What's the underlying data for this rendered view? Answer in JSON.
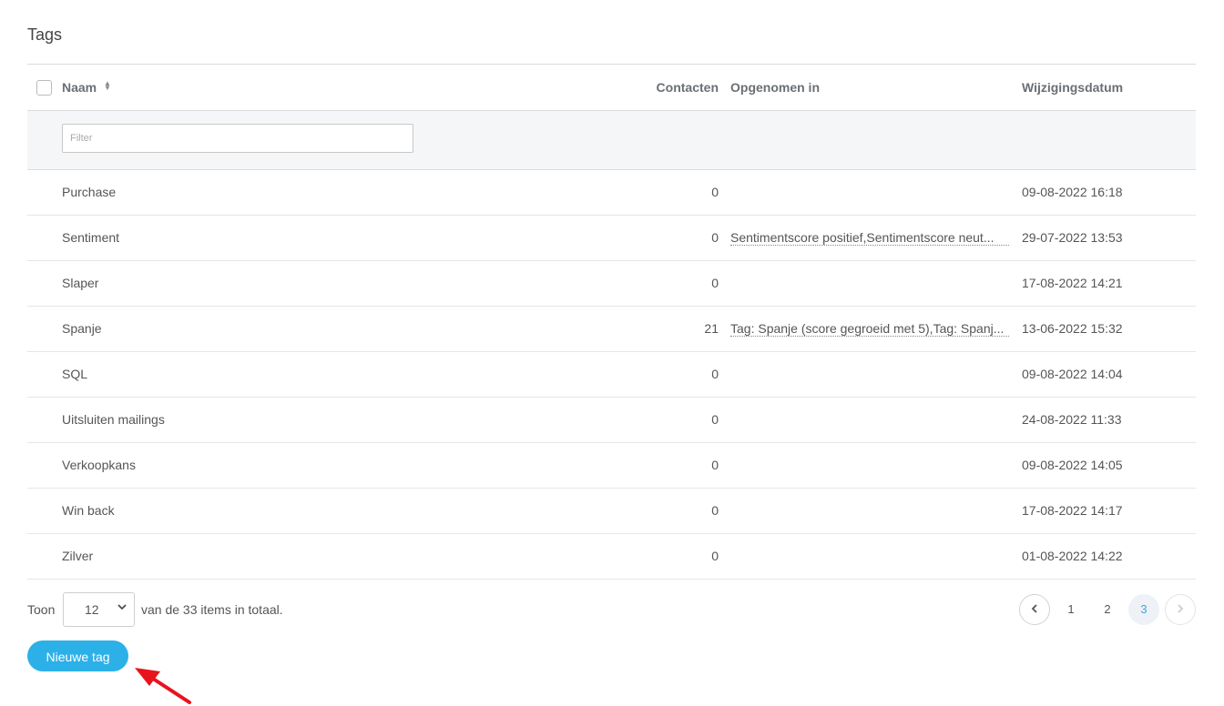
{
  "page": {
    "title": "Tags"
  },
  "table": {
    "headers": {
      "name": "Naam",
      "contacts": "Contacten",
      "included": "Opgenomen in",
      "date": "Wijzigingsdatum"
    },
    "filter_placeholder": "Filter",
    "rows": [
      {
        "name": "Purchase",
        "contacts": "0",
        "included": "",
        "date": "09-08-2022 16:18"
      },
      {
        "name": "Sentiment",
        "contacts": "0",
        "included": "Sentimentscore positief,Sentimentscore neut...",
        "date": "29-07-2022 13:53"
      },
      {
        "name": "Slaper",
        "contacts": "0",
        "included": "",
        "date": "17-08-2022 14:21"
      },
      {
        "name": "Spanje",
        "contacts": "21",
        "included": "Tag: Spanje (score gegroeid met 5),Tag: Spanj...",
        "date": "13-06-2022 15:32"
      },
      {
        "name": "SQL",
        "contacts": "0",
        "included": "",
        "date": "09-08-2022 14:04"
      },
      {
        "name": "Uitsluiten mailings",
        "contacts": "0",
        "included": "",
        "date": "24-08-2022 11:33"
      },
      {
        "name": "Verkoopkans",
        "contacts": "0",
        "included": "",
        "date": "09-08-2022 14:05"
      },
      {
        "name": "Win back",
        "contacts": "0",
        "included": "",
        "date": "17-08-2022 14:17"
      },
      {
        "name": "Zilver",
        "contacts": "0",
        "included": "",
        "date": "01-08-2022 14:22"
      }
    ]
  },
  "footer": {
    "show_label": "Toon",
    "page_size": "12",
    "total_text": "van de 33 items in totaal.",
    "pages": [
      "1",
      "2",
      "3"
    ],
    "active_page": "3",
    "new_button": "Nieuwe tag"
  },
  "colors": {
    "accent": "#2cb0e8",
    "annotation_arrow": "#e8141c"
  }
}
